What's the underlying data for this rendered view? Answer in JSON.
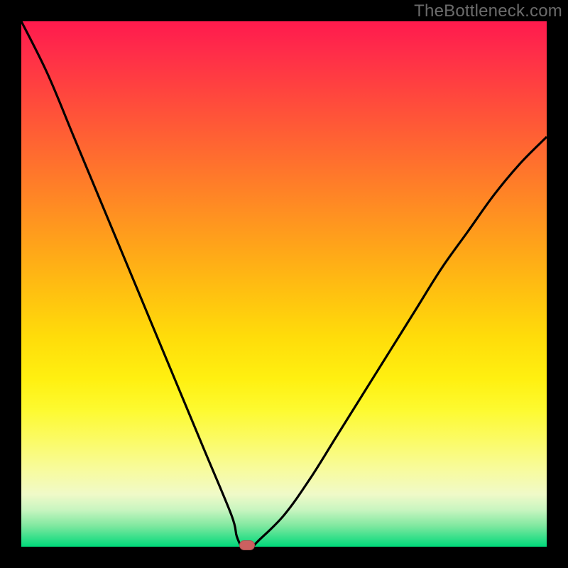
{
  "watermark": "TheBottleneck.com",
  "colors": {
    "curve_stroke": "#000000",
    "marker_fill": "#cc6060"
  },
  "chart_data": {
    "type": "line",
    "title": "",
    "xlabel": "",
    "ylabel": "",
    "xlim": [
      0,
      100
    ],
    "ylim": [
      0,
      100
    ],
    "grid": false,
    "legend": false,
    "series": [
      {
        "name": "bottleneck-curve",
        "x": [
          0,
          5,
          10,
          15,
          20,
          25,
          30,
          35,
          40,
          41,
          42,
          43,
          44,
          45,
          50,
          55,
          60,
          65,
          70,
          75,
          80,
          85,
          90,
          95,
          100
        ],
        "y": [
          100,
          90,
          78,
          66,
          54,
          42,
          30,
          18,
          6,
          2,
          0,
          0,
          0,
          1,
          6,
          13,
          21,
          29,
          37,
          45,
          53,
          60,
          67,
          73,
          78
        ]
      }
    ],
    "annotations": [
      {
        "name": "optimal-marker",
        "x": 43,
        "y": 0
      }
    ],
    "notes": "V-shaped bottleneck curve; left branch steep from top-left to minimum near x≈43, right branch rises more gently toward upper-right. Background is a vertical rainbow gradient (red→green). Values estimated from pixels; no axis ticks or labels visible."
  },
  "marker": {
    "x_pct": 43,
    "y_pct": 0
  }
}
